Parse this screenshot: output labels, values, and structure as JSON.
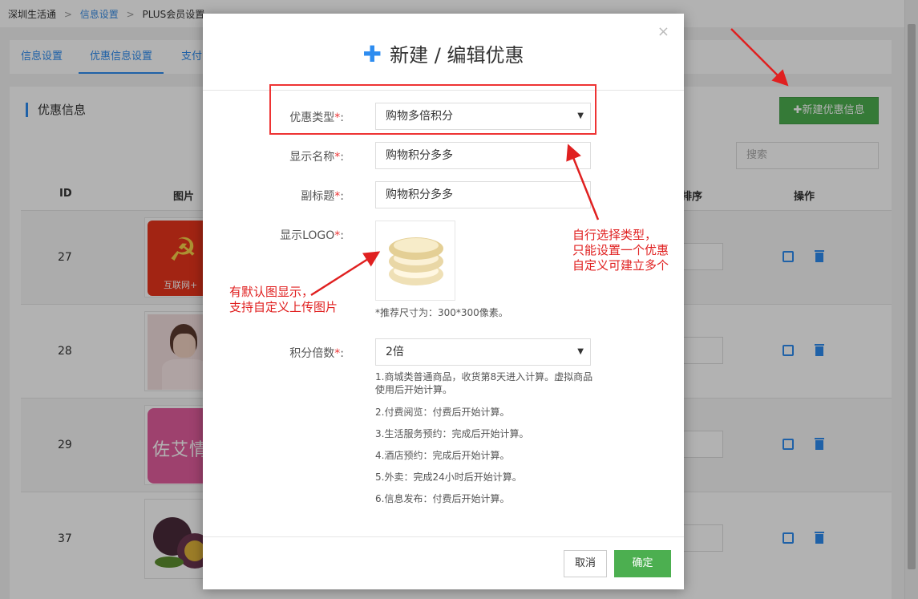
{
  "breadcrumb": {
    "root": "深圳生活通",
    "sep": ">",
    "level1": "信息设置",
    "level2": "PLUS会员设置"
  },
  "tabs": [
    "信息设置",
    "优惠信息设置",
    "支付"
  ],
  "panel": {
    "title": "优惠信息",
    "new_button": "✚新建优惠信息",
    "search_placeholder": "搜索"
  },
  "table": {
    "headers": {
      "id": "ID",
      "image": "图片",
      "sort": "排序",
      "action": "操作"
    },
    "rows": [
      {
        "id": "27",
        "thumb_text": "互联网+"
      },
      {
        "id": "28"
      },
      {
        "id": "29",
        "thumb_text": "佐艾情"
      },
      {
        "id": "37"
      }
    ]
  },
  "modal": {
    "title": "新建 / 编辑优惠",
    "close": "×",
    "labels": {
      "type": "优惠类型",
      "name": "显示名称",
      "subtitle": "副标题",
      "logo": "显示LOGO",
      "multiple": "积分倍数",
      "required": "*",
      "colon": ":"
    },
    "fields": {
      "type_value": "购物多倍积分",
      "name_value": "购物积分多多",
      "subtitle_value": "购物积分多多",
      "multiple_value": "2倍"
    },
    "logo_hint": "*推荐尺寸为：300*300像素。",
    "notes": [
      "1.商城类普通商品，收货第8天进入计算。虚拟商品使用后开始计算。",
      "2.付费阅览：付费后开始计算。",
      "3.生活服务预约：完成后开始计算。",
      "4.酒店预约：完成后开始计算。",
      "5.外卖：完成24小时后开始计算。",
      "6.信息发布：付费后开始计算。"
    ],
    "cancel": "取消",
    "ok": "确定"
  },
  "annotations": {
    "type_note": [
      "自行选择类型，",
      "只能设置一个优惠",
      "自定义可建立多个"
    ],
    "logo_note": [
      "有默认图显示，",
      "支持自定义上传图片"
    ]
  },
  "colors": {
    "accent": "#2d8cf0",
    "green": "#4caf50",
    "annotation_red": "#e02020"
  }
}
